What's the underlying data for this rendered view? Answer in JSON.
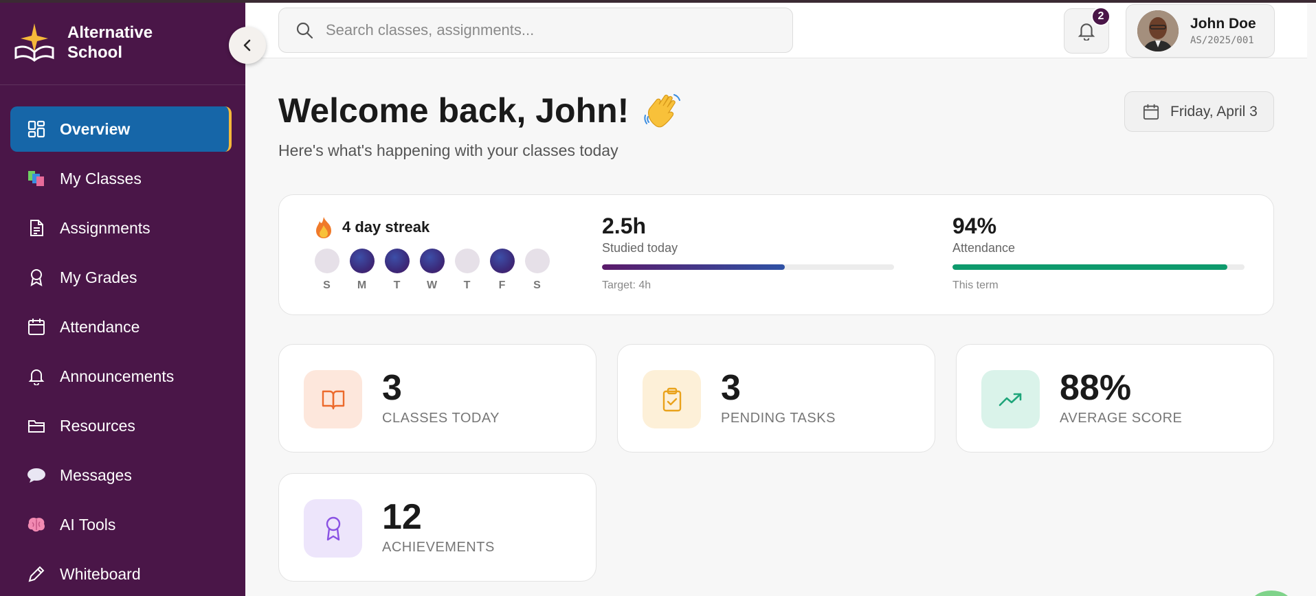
{
  "brand": {
    "name": "Alternative School"
  },
  "sidebar": {
    "items": [
      {
        "label": "Overview",
        "icon": "grid-icon",
        "active": true
      },
      {
        "label": "My Classes",
        "icon": "books-icon"
      },
      {
        "label": "Assignments",
        "icon": "document-icon"
      },
      {
        "label": "My Grades",
        "icon": "award-icon"
      },
      {
        "label": "Attendance",
        "icon": "calendar-icon"
      },
      {
        "label": "Announcements",
        "icon": "bell-icon"
      },
      {
        "label": "Resources",
        "icon": "folder-icon"
      },
      {
        "label": "Messages",
        "icon": "speech-bubble-icon"
      },
      {
        "label": "AI Tools",
        "icon": "brain-icon"
      },
      {
        "label": "Whiteboard",
        "icon": "pencil-icon"
      }
    ]
  },
  "header": {
    "search_placeholder": "Search classes, assignments...",
    "notification_count": "2",
    "user_name": "John Doe",
    "user_id": "AS/2025/001"
  },
  "welcome": {
    "title": "Welcome back, John!",
    "subtitle": "Here's what's happening with your classes today",
    "date": "Friday, April 3"
  },
  "streak": {
    "label": "4 day streak",
    "days": [
      {
        "letter": "S",
        "done": false
      },
      {
        "letter": "M",
        "done": true
      },
      {
        "letter": "T",
        "done": true
      },
      {
        "letter": "W",
        "done": true
      },
      {
        "letter": "T",
        "done": false
      },
      {
        "letter": "F",
        "done": true
      },
      {
        "letter": "S",
        "done": false
      }
    ]
  },
  "study": {
    "value": "2.5h",
    "label": "Studied today",
    "note": "Target: 4h",
    "progress": 0.625
  },
  "attendance": {
    "value": "94%",
    "label": "Attendance",
    "note": "This term",
    "progress": 0.94
  },
  "cards": [
    {
      "value": "3",
      "label": "CLASSES TODAY",
      "icon": "book-icon",
      "bg": "#fde7dc",
      "color": "#ec6a2c"
    },
    {
      "value": "3",
      "label": "PENDING TASKS",
      "icon": "clipboard-check-icon",
      "bg": "#fdf0d8",
      "color": "#e9a21b"
    },
    {
      "value": "88%",
      "label": "AVERAGE SCORE",
      "icon": "trending-up-icon",
      "bg": "#daf3ea",
      "color": "#1fa57a"
    },
    {
      "value": "12",
      "label": "ACHIEVEMENTS",
      "icon": "award-icon",
      "bg": "#ede5fb",
      "color": "#8a52e3"
    }
  ],
  "colors": {
    "sidebar": "#4a1648",
    "active_nav": "#1666a8",
    "active_accent": "#f5b83a",
    "attendance_bar": "#0e9a6c"
  }
}
